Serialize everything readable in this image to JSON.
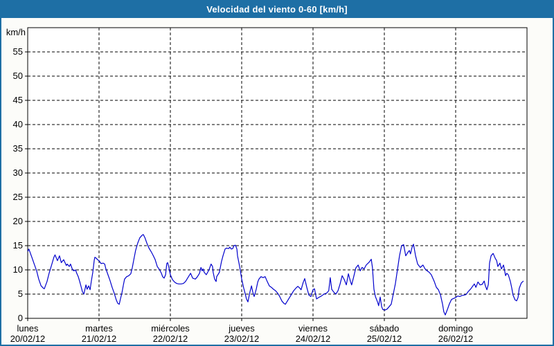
{
  "title": "Velocidad del viento 0-60 [km/h]",
  "colors": {
    "titlebar": "#1e6fa5",
    "window_border": "#1e6fa5",
    "title_text": "#ffffff",
    "page_background": "#fcfcf9",
    "plot_background": "#ffffff",
    "line": "#0000cc",
    "grid": "#000000",
    "axis": "#000000",
    "label_text": "#000000"
  },
  "y_axis": {
    "unit_label": "km/h",
    "min": 0,
    "max": 60,
    "tick_step": 5,
    "tick_labels": [
      "0",
      "5",
      "10",
      "15",
      "20",
      "25",
      "30",
      "35",
      "40",
      "45",
      "50",
      "55"
    ]
  },
  "x_axis": {
    "days": [
      {
        "name": "lunes",
        "date": "20/02/12"
      },
      {
        "name": "martes",
        "date": "21/02/12"
      },
      {
        "name": "miércoles",
        "date": "22/02/12"
      },
      {
        "name": "jueves",
        "date": "23/02/12"
      },
      {
        "name": "viernes",
        "date": "24/02/12"
      },
      {
        "name": "sábado",
        "date": "25/02/12"
      },
      {
        "name": "domingo",
        "date": "26/02/12"
      }
    ],
    "hours_per_day": 24
  },
  "chart_data": {
    "type": "line",
    "title": "Velocidad del viento 0-60 [km/h]",
    "ylabel": "km/h",
    "xlabel": "",
    "ylim": [
      0,
      60
    ],
    "xlim": [
      0,
      168
    ],
    "x_unit": "hours since lunes 20/02/12 00:00",
    "grid": true,
    "legend": "none",
    "series": [
      {
        "name": "velocidad del viento",
        "color": "#0000cc",
        "points": [
          [
            0,
            13.8
          ],
          [
            0.4,
            14.3
          ],
          [
            1.4,
            12.6
          ],
          [
            2.2,
            11.2
          ],
          [
            3,
            9.8
          ],
          [
            3.7,
            8.1
          ],
          [
            4.5,
            6.7
          ],
          [
            5.3,
            6.2
          ],
          [
            5.6,
            6.1
          ],
          [
            6.5,
            7.6
          ],
          [
            7.2,
            9.3
          ],
          [
            8,
            10.9
          ],
          [
            8.8,
            12.6
          ],
          [
            9.2,
            13.1
          ],
          [
            10,
            11.9
          ],
          [
            10.7,
            12.9
          ],
          [
            11.3,
            11.5
          ],
          [
            12.1,
            12.1
          ],
          [
            13,
            10.9
          ],
          [
            13.3,
            11.2
          ],
          [
            14,
            10.7
          ],
          [
            14.4,
            11.2
          ],
          [
            15.1,
            10
          ],
          [
            15.6,
            9.8
          ],
          [
            16.1,
            10
          ],
          [
            16.5,
            9.3
          ],
          [
            17,
            8.6
          ],
          [
            17.5,
            7.6
          ],
          [
            17.9,
            6.7
          ],
          [
            18.4,
            5.5
          ],
          [
            18.9,
            5
          ],
          [
            19.6,
            6.9
          ],
          [
            20,
            6
          ],
          [
            20.5,
            6.7
          ],
          [
            21,
            5.9
          ],
          [
            21.4,
            7.6
          ],
          [
            21.9,
            9.5
          ],
          [
            22.4,
            12
          ],
          [
            22.6,
            12.6
          ],
          [
            23.1,
            12.4
          ],
          [
            23.5,
            12.1
          ],
          [
            24,
            11.9
          ],
          [
            24.7,
            11.3
          ],
          [
            25.4,
            11.4
          ],
          [
            25.9,
            11.2
          ],
          [
            26.3,
            10.2
          ],
          [
            27,
            9
          ],
          [
            27.7,
            7.8
          ],
          [
            28.4,
            6.4
          ],
          [
            29.1,
            5.2
          ],
          [
            29.8,
            3.8
          ],
          [
            30.3,
            3.1
          ],
          [
            30.8,
            2.9
          ],
          [
            31.2,
            4
          ],
          [
            31.7,
            5.2
          ],
          [
            32.2,
            6.9
          ],
          [
            32.6,
            8.1
          ],
          [
            33.3,
            8.6
          ],
          [
            34,
            8.8
          ],
          [
            34.7,
            9.2
          ],
          [
            35.2,
            10.5
          ],
          [
            35.7,
            12.1
          ],
          [
            36.3,
            14
          ],
          [
            37,
            15.5
          ],
          [
            37.7,
            16.6
          ],
          [
            38.4,
            17.1
          ],
          [
            38.9,
            17.3
          ],
          [
            39.4,
            16.7
          ],
          [
            40.1,
            15.5
          ],
          [
            40.8,
            14.5
          ],
          [
            41.5,
            13.8
          ],
          [
            42.2,
            13
          ],
          [
            42.9,
            12.1
          ],
          [
            43.6,
            10.7
          ],
          [
            44.3,
            10.1
          ],
          [
            45,
            9.3
          ],
          [
            45.4,
            8.6
          ],
          [
            45.9,
            8.3
          ],
          [
            46.4,
            9
          ],
          [
            46.8,
            11.3
          ],
          [
            47.1,
            11.5
          ],
          [
            47.5,
            10.5
          ],
          [
            48,
            9
          ],
          [
            48.7,
            8
          ],
          [
            49.4,
            7.5
          ],
          [
            50.1,
            7.2
          ],
          [
            50.8,
            7.1
          ],
          [
            51.7,
            7.1
          ],
          [
            52.4,
            7.2
          ],
          [
            53.1,
            7.6
          ],
          [
            54.1,
            8.6
          ],
          [
            54.8,
            9.3
          ],
          [
            55.5,
            8.3
          ],
          [
            56.4,
            8.1
          ],
          [
            57.1,
            8.6
          ],
          [
            57.8,
            9.3
          ],
          [
            58.3,
            10.5
          ],
          [
            58.7,
            9.8
          ],
          [
            59,
            10.2
          ],
          [
            59.4,
            9.5
          ],
          [
            60.1,
            9
          ],
          [
            61,
            10
          ],
          [
            61.7,
            11.2
          ],
          [
            62.2,
            10.7
          ],
          [
            62.4,
            9.5
          ],
          [
            62.9,
            8.1
          ],
          [
            63.4,
            7.6
          ],
          [
            63.6,
            8.6
          ],
          [
            64.5,
            9.5
          ],
          [
            65.2,
            11.7
          ],
          [
            65.7,
            12.9
          ],
          [
            66.4,
            14.3
          ],
          [
            66.9,
            14.5
          ],
          [
            67.6,
            14.4
          ],
          [
            68,
            14.7
          ],
          [
            68.5,
            14.3
          ],
          [
            69,
            14.4
          ],
          [
            69.4,
            15
          ],
          [
            69.9,
            15.1
          ],
          [
            70.4,
            14.3
          ],
          [
            70.6,
            12.9
          ],
          [
            71.1,
            11.4
          ],
          [
            71.5,
            10
          ],
          [
            72,
            8.1
          ],
          [
            72.7,
            6.2
          ],
          [
            73.2,
            5
          ],
          [
            73.6,
            4
          ],
          [
            74.1,
            3.4
          ],
          [
            74.8,
            5.5
          ],
          [
            75.3,
            6.7
          ],
          [
            75.7,
            5.5
          ],
          [
            76.2,
            4.5
          ],
          [
            76.9,
            6
          ],
          [
            77.4,
            7.5
          ],
          [
            77.8,
            8.1
          ],
          [
            78.5,
            8.6
          ],
          [
            79.2,
            8.4
          ],
          [
            79.9,
            8.6
          ],
          [
            80.6,
            7.6
          ],
          [
            81.3,
            6.7
          ],
          [
            82,
            6.4
          ],
          [
            82.7,
            6
          ],
          [
            83.4,
            5.7
          ],
          [
            84.1,
            5.2
          ],
          [
            84.8,
            4.5
          ],
          [
            85.5,
            3.6
          ],
          [
            86.2,
            3.1
          ],
          [
            86.7,
            2.9
          ],
          [
            87.4,
            3.6
          ],
          [
            88.1,
            4.3
          ],
          [
            88.8,
            5
          ],
          [
            89.5,
            5.7
          ],
          [
            90.2,
            6.2
          ],
          [
            90.9,
            6.6
          ],
          [
            91.6,
            6.2
          ],
          [
            92,
            5.9
          ],
          [
            92.7,
            7.4
          ],
          [
            93.2,
            8.2
          ],
          [
            93.9,
            6.4
          ],
          [
            94.6,
            4.8
          ],
          [
            95.3,
            4.5
          ],
          [
            96,
            5.9
          ],
          [
            96.5,
            6.1
          ],
          [
            97.2,
            4
          ],
          [
            97.9,
            4.3
          ],
          [
            98.8,
            4.6
          ],
          [
            99.7,
            5
          ],
          [
            100.6,
            5.2
          ],
          [
            101.3,
            5.7
          ],
          [
            101.8,
            8.4
          ],
          [
            102.3,
            6
          ],
          [
            103,
            5.4
          ],
          [
            103.7,
            5
          ],
          [
            104.4,
            5.7
          ],
          [
            105.1,
            7.1
          ],
          [
            105.8,
            8.8
          ],
          [
            106.5,
            8
          ],
          [
            107.2,
            6.9
          ],
          [
            107.9,
            9.2
          ],
          [
            108.6,
            7.6
          ],
          [
            109,
            6.9
          ],
          [
            109.7,
            8.6
          ],
          [
            110.4,
            10.4
          ],
          [
            111.2,
            11
          ],
          [
            111.9,
            9.8
          ],
          [
            112.5,
            10.5
          ],
          [
            113.2,
            10.2
          ],
          [
            113.9,
            11
          ],
          [
            114.9,
            11.6
          ],
          [
            115.6,
            12.2
          ],
          [
            116,
            10.5
          ],
          [
            116.5,
            6
          ],
          [
            117,
            4.5
          ],
          [
            117.7,
            3.4
          ],
          [
            118.1,
            2.6
          ],
          [
            118.6,
            4.4
          ],
          [
            119.1,
            2.4
          ],
          [
            119.5,
            1.8
          ],
          [
            120.2,
            1.7
          ],
          [
            120.9,
            1.9
          ],
          [
            121.6,
            2.4
          ],
          [
            122.3,
            2.9
          ],
          [
            123,
            5
          ],
          [
            123.7,
            7.1
          ],
          [
            124.4,
            10
          ],
          [
            125.1,
            12.9
          ],
          [
            125.8,
            15
          ],
          [
            126.5,
            15.2
          ],
          [
            127.2,
            12.9
          ],
          [
            127.9,
            13.6
          ],
          [
            128.4,
            14
          ],
          [
            128.8,
            13.3
          ],
          [
            129.3,
            14.6
          ],
          [
            129.8,
            15.3
          ],
          [
            130.5,
            12.9
          ],
          [
            131.2,
            11.2
          ],
          [
            132.1,
            10.5
          ],
          [
            133,
            11
          ],
          [
            133.7,
            10.2
          ],
          [
            134.4,
            9.8
          ],
          [
            135.1,
            9.5
          ],
          [
            135.8,
            9
          ],
          [
            136.8,
            7.6
          ],
          [
            137.5,
            6.4
          ],
          [
            138.2,
            5.9
          ],
          [
            138.9,
            4.8
          ],
          [
            139.6,
            2.9
          ],
          [
            140,
            1.4
          ],
          [
            140.5,
            0.7
          ],
          [
            141.2,
            1.8
          ],
          [
            141.9,
            3
          ],
          [
            142.6,
            3.9
          ],
          [
            143.3,
            4.1
          ],
          [
            144,
            4.3
          ],
          [
            144.7,
            4.6
          ],
          [
            145.4,
            4.5
          ],
          [
            146.1,
            4.7
          ],
          [
            146.8,
            4.8
          ],
          [
            147.5,
            4.9
          ],
          [
            148.2,
            5.5
          ],
          [
            149.1,
            6.1
          ],
          [
            149.8,
            6.7
          ],
          [
            150.3,
            7.1
          ],
          [
            150.8,
            6.4
          ],
          [
            151.5,
            7.5
          ],
          [
            152.2,
            6.9
          ],
          [
            152.9,
            7
          ],
          [
            153.6,
            7.7
          ],
          [
            154,
            6.7
          ],
          [
            154.5,
            5.9
          ],
          [
            155,
            7
          ],
          [
            155.4,
            11.4
          ],
          [
            155.9,
            12.9
          ],
          [
            156.6,
            13.4
          ],
          [
            157.3,
            12.4
          ],
          [
            157.8,
            11.9
          ],
          [
            158.2,
            10.7
          ],
          [
            158.9,
            11.4
          ],
          [
            159.4,
            10.2
          ],
          [
            160.1,
            11
          ],
          [
            160.8,
            8.8
          ],
          [
            161.2,
            9.3
          ],
          [
            161.7,
            9
          ],
          [
            162.4,
            7.6
          ],
          [
            162.9,
            6.2
          ],
          [
            163.3,
            4.8
          ],
          [
            164,
            3.8
          ],
          [
            164.5,
            3.6
          ],
          [
            165,
            4.3
          ],
          [
            165.4,
            6.2
          ],
          [
            166.1,
            7.3
          ],
          [
            166.8,
            7.7
          ]
        ]
      }
    ]
  }
}
